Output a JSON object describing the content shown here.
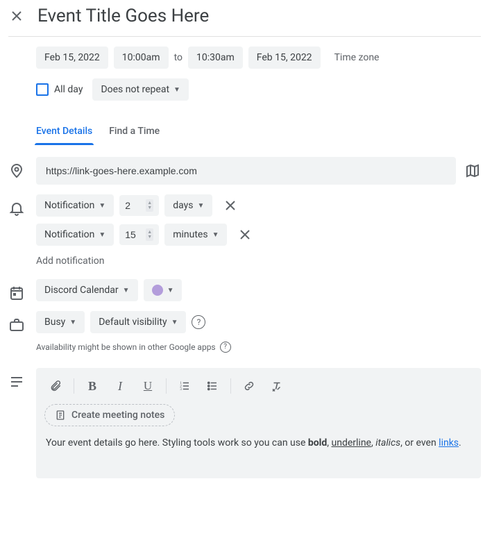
{
  "header": {
    "title": "Event Title Goes Here"
  },
  "datetime": {
    "start_date": "Feb 15, 2022",
    "start_time": "10:00am",
    "to": "to",
    "end_time": "10:30am",
    "end_date": "Feb 15, 2022",
    "timezone_label": "Time zone"
  },
  "allday": {
    "label": "All day",
    "checked": false
  },
  "recurrence": {
    "label": "Does not repeat"
  },
  "tabs": {
    "details": "Event Details",
    "find_time": "Find a Time"
  },
  "location": {
    "value": "https://link-goes-here.example.com"
  },
  "notifications": [
    {
      "type": "Notification",
      "value": "2",
      "unit": "days"
    },
    {
      "type": "Notification",
      "value": "15",
      "unit": "minutes"
    }
  ],
  "notifications_static": {
    "n0_type": "Notification",
    "n0_value": "2",
    "n0_unit": "days",
    "n1_type": "Notification",
    "n1_value": "15",
    "n1_unit": "minutes"
  },
  "add_notification": "Add notification",
  "calendar": {
    "name": "Discord Calendar",
    "color": "#b39ddb"
  },
  "availability": {
    "status": "Busy",
    "visibility": "Default visibility",
    "hint": "Availability might be shown in other Google apps"
  },
  "description": {
    "meeting_notes_label": "Create meeting notes",
    "text_prefix": "Your event details go here. Styling tools work so you can use ",
    "bold": "bold",
    "sep1": ", ",
    "underline": "underline",
    "sep2": ", ",
    "italics": "italics",
    "sep3": ", or even ",
    "link": "links",
    "suffix": "."
  }
}
